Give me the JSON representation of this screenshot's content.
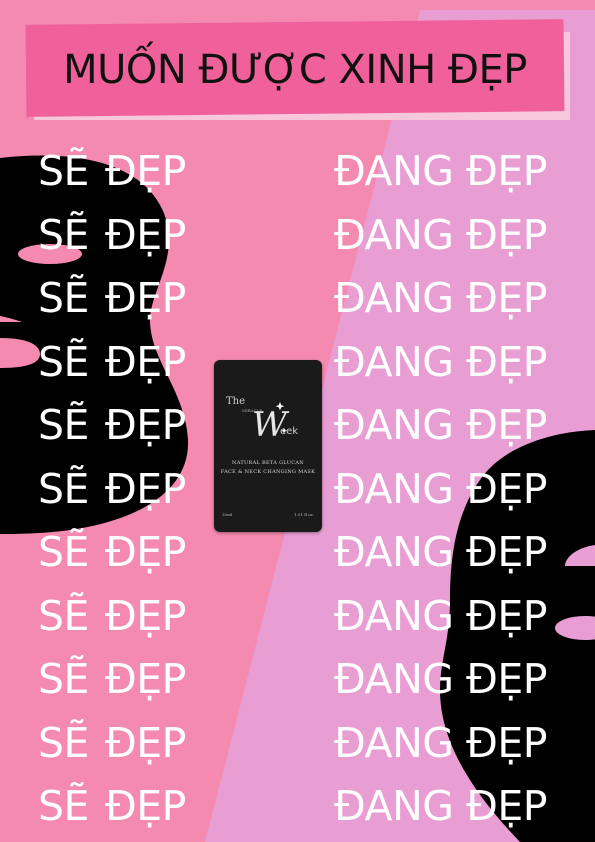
{
  "colors": {
    "pink": "#f48ab0",
    "lavender": "#e89ed3",
    "banner": "#f0609a",
    "mask": "#000000",
    "text": "#ffffff"
  },
  "headline": "MUỐN ĐƯỢC XINH ĐẸP",
  "left_column": {
    "word1": "SẼ",
    "word2": "ĐẸP",
    "repeat": 11
  },
  "right_column": {
    "text": "ĐANG ĐẸP",
    "repeat": 11
  },
  "product": {
    "logo_the": "The",
    "logo_w": "W",
    "logo_small": "MIRACLE",
    "logo_eek": "eek",
    "line1": "NATURAL BETA GLUCAN",
    "line2": "FACE & NECK CHANGING MASK",
    "foot_left": "30ml",
    "foot_right": "1.01 fl.oz."
  }
}
